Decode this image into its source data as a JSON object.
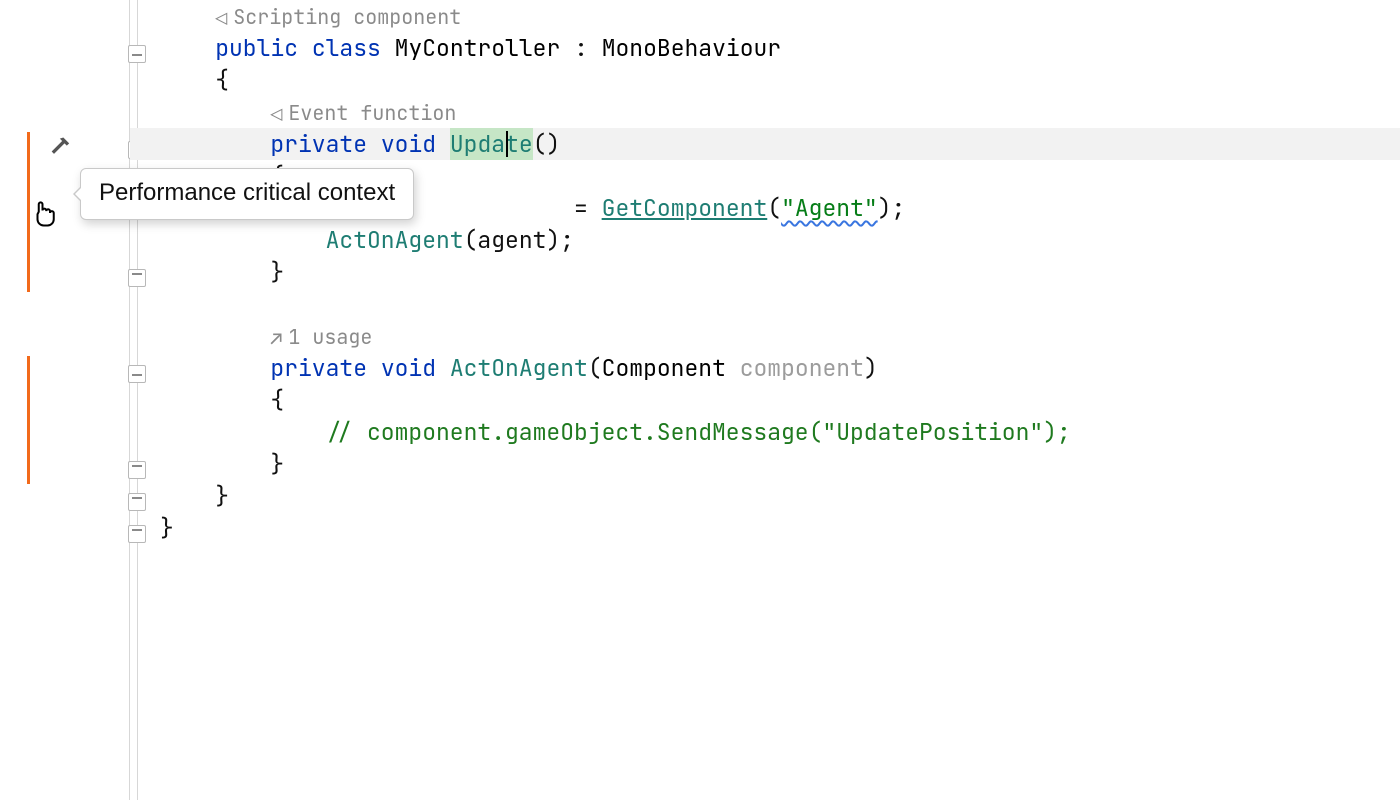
{
  "colors": {
    "keyword": "#0033b3",
    "method": "#1e7d73",
    "string": "#067d17",
    "comment": "#1f7a1f",
    "hint": "#8a8a8a",
    "param": "#9c9c9c",
    "highlight_line_bg": "#f2f2f2",
    "caret_bg": "#c6e6c6",
    "marker": "#f26a1b"
  },
  "hints": {
    "scripting_component": "Scripting component",
    "event_function": "Event function",
    "usages": "1 usage"
  },
  "tooltip": {
    "text": "Performance critical context"
  },
  "gutter_icons": {
    "hammer": "hammer-icon",
    "pointer": "pointer-cursor-icon"
  },
  "code": {
    "l1": {
      "public": "public",
      "class": "class",
      "name": "MyController",
      "colon": ":",
      "base": "MonoBehaviour"
    },
    "brace_open": "{",
    "brace_close": "}",
    "update": {
      "private": "private",
      "void": "void",
      "name": "Update",
      "parens": "()"
    },
    "body1": {
      "eq": "=",
      "call": "GetComponent",
      "paren_open": "(",
      "str": "\"Agent\"",
      "paren_close_semi": ");"
    },
    "body2": {
      "call": "ActOnAgent",
      "arg": "(agent);"
    },
    "act": {
      "private": "private",
      "void": "void",
      "name": "ActOnAgent",
      "paren_open": "(",
      "type": "Component",
      "space": " ",
      "param": "component",
      "paren_close": ")"
    },
    "comment": "// component.gameObject.SendMessage(\"UpdatePosition\");"
  }
}
